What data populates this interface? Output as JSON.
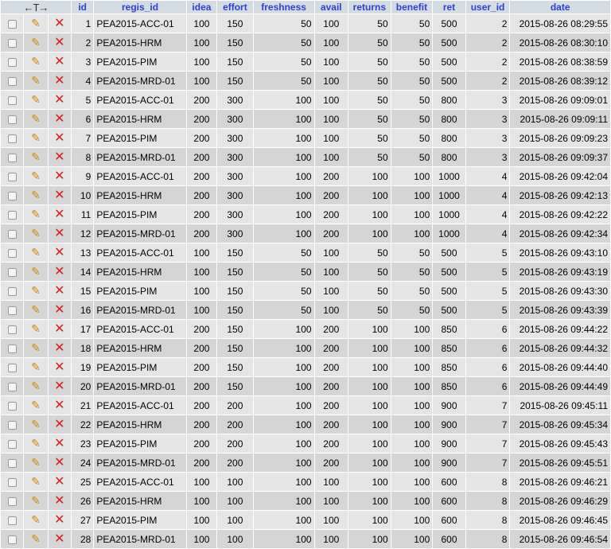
{
  "header": {
    "arrows_label": "←T→",
    "columns": [
      "id",
      "regis_id",
      "idea",
      "effort",
      "freshness",
      "avail",
      "returns",
      "benefit",
      "ret",
      "user_id",
      "date"
    ]
  },
  "icons": {
    "edit": "pencil-icon",
    "delete": "delete-x-icon"
  },
  "colors": {
    "row_odd": "#e5e5e5",
    "row_even": "#d5d5d5",
    "header_bg": "#d3dce3",
    "header_text": "#2f3fd1",
    "delete": "#d81e1e",
    "edit": "#d08a10"
  },
  "rows": [
    [
      "1",
      "PEA2015-ACC-01",
      "100",
      "150",
      "50",
      "100",
      "50",
      "50",
      "500",
      "2",
      "2015-08-26 08:29:55"
    ],
    [
      "2",
      "PEA2015-HRM",
      "100",
      "150",
      "50",
      "100",
      "50",
      "50",
      "500",
      "2",
      "2015-08-26 08:30:10"
    ],
    [
      "3",
      "PEA2015-PIM",
      "100",
      "150",
      "50",
      "100",
      "50",
      "50",
      "500",
      "2",
      "2015-08-26 08:38:59"
    ],
    [
      "4",
      "PEA2015-MRD-01",
      "100",
      "150",
      "50",
      "100",
      "50",
      "50",
      "500",
      "2",
      "2015-08-26 08:39:12"
    ],
    [
      "5",
      "PEA2015-ACC-01",
      "200",
      "300",
      "100",
      "100",
      "50",
      "50",
      "800",
      "3",
      "2015-08-26 09:09:01"
    ],
    [
      "6",
      "PEA2015-HRM",
      "200",
      "300",
      "100",
      "100",
      "50",
      "50",
      "800",
      "3",
      "2015-08-26 09:09:11"
    ],
    [
      "7",
      "PEA2015-PIM",
      "200",
      "300",
      "100",
      "100",
      "50",
      "50",
      "800",
      "3",
      "2015-08-26 09:09:23"
    ],
    [
      "8",
      "PEA2015-MRD-01",
      "200",
      "300",
      "100",
      "100",
      "50",
      "50",
      "800",
      "3",
      "2015-08-26 09:09:37"
    ],
    [
      "9",
      "PEA2015-ACC-01",
      "200",
      "300",
      "100",
      "200",
      "100",
      "100",
      "1000",
      "4",
      "2015-08-26 09:42:04"
    ],
    [
      "10",
      "PEA2015-HRM",
      "200",
      "300",
      "100",
      "200",
      "100",
      "100",
      "1000",
      "4",
      "2015-08-26 09:42:13"
    ],
    [
      "11",
      "PEA2015-PIM",
      "200",
      "300",
      "100",
      "200",
      "100",
      "100",
      "1000",
      "4",
      "2015-08-26 09:42:22"
    ],
    [
      "12",
      "PEA2015-MRD-01",
      "200",
      "300",
      "100",
      "200",
      "100",
      "100",
      "1000",
      "4",
      "2015-08-26 09:42:34"
    ],
    [
      "13",
      "PEA2015-ACC-01",
      "100",
      "150",
      "50",
      "100",
      "50",
      "50",
      "500",
      "5",
      "2015-08-26 09:43:10"
    ],
    [
      "14",
      "PEA2015-HRM",
      "100",
      "150",
      "50",
      "100",
      "50",
      "50",
      "500",
      "5",
      "2015-08-26 09:43:19"
    ],
    [
      "15",
      "PEA2015-PIM",
      "100",
      "150",
      "50",
      "100",
      "50",
      "50",
      "500",
      "5",
      "2015-08-26 09:43:30"
    ],
    [
      "16",
      "PEA2015-MRD-01",
      "100",
      "150",
      "50",
      "100",
      "50",
      "50",
      "500",
      "5",
      "2015-08-26 09:43:39"
    ],
    [
      "17",
      "PEA2015-ACC-01",
      "200",
      "150",
      "100",
      "200",
      "100",
      "100",
      "850",
      "6",
      "2015-08-26 09:44:22"
    ],
    [
      "18",
      "PEA2015-HRM",
      "200",
      "150",
      "100",
      "200",
      "100",
      "100",
      "850",
      "6",
      "2015-08-26 09:44:32"
    ],
    [
      "19",
      "PEA2015-PIM",
      "200",
      "150",
      "100",
      "200",
      "100",
      "100",
      "850",
      "6",
      "2015-08-26 09:44:40"
    ],
    [
      "20",
      "PEA2015-MRD-01",
      "200",
      "150",
      "100",
      "200",
      "100",
      "100",
      "850",
      "6",
      "2015-08-26 09:44:49"
    ],
    [
      "21",
      "PEA2015-ACC-01",
      "200",
      "200",
      "100",
      "200",
      "100",
      "100",
      "900",
      "7",
      "2015-08-26 09:45:11"
    ],
    [
      "22",
      "PEA2015-HRM",
      "200",
      "200",
      "100",
      "200",
      "100",
      "100",
      "900",
      "7",
      "2015-08-26 09:45:34"
    ],
    [
      "23",
      "PEA2015-PIM",
      "200",
      "200",
      "100",
      "200",
      "100",
      "100",
      "900",
      "7",
      "2015-08-26 09:45:43"
    ],
    [
      "24",
      "PEA2015-MRD-01",
      "200",
      "200",
      "100",
      "200",
      "100",
      "100",
      "900",
      "7",
      "2015-08-26 09:45:51"
    ],
    [
      "25",
      "PEA2015-ACC-01",
      "100",
      "100",
      "100",
      "100",
      "100",
      "100",
      "600",
      "8",
      "2015-08-26 09:46:21"
    ],
    [
      "26",
      "PEA2015-HRM",
      "100",
      "100",
      "100",
      "100",
      "100",
      "100",
      "600",
      "8",
      "2015-08-26 09:46:29"
    ],
    [
      "27",
      "PEA2015-PIM",
      "100",
      "100",
      "100",
      "100",
      "100",
      "100",
      "600",
      "8",
      "2015-08-26 09:46:45"
    ],
    [
      "28",
      "PEA2015-MRD-01",
      "100",
      "100",
      "100",
      "100",
      "100",
      "100",
      "600",
      "8",
      "2015-08-26 09:46:54"
    ]
  ]
}
